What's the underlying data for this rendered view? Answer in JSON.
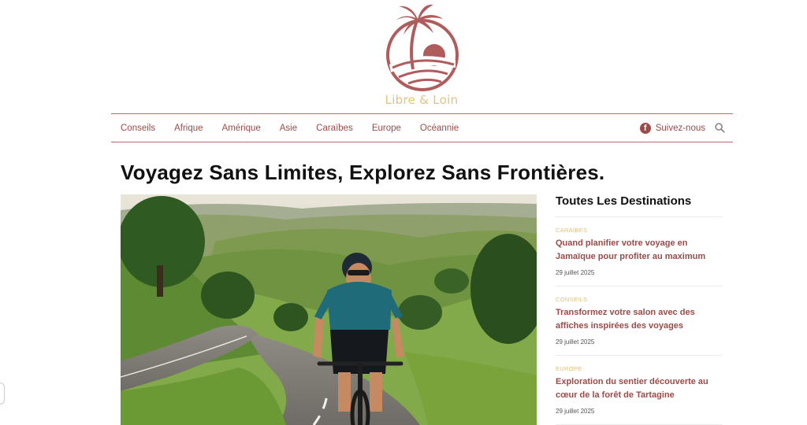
{
  "site": {
    "name": "Libre & Loin"
  },
  "nav": {
    "links": [
      "Conseils",
      "Afrique",
      "Amérique",
      "Asie",
      "Caraïbes",
      "Europe",
      "Océannie"
    ],
    "follow_label": "Suivez-nous",
    "follow_icon": "facebook-icon",
    "search_icon": "search-icon"
  },
  "headline": "Voyagez Sans Limites, Explorez Sans Frontières.",
  "sidebar": {
    "title": "Toutes Les Destinations",
    "articles": [
      {
        "category": "CARAÏBES",
        "title": "Quand planifier votre voyage en Jamaïque pour profiter au maximum",
        "date": "29 juillet 2025"
      },
      {
        "category": "CONSEILS",
        "title": "Transformez votre salon avec des affiches inspirées des voyages",
        "date": "29 juillet 2025"
      },
      {
        "category": "EUROPE",
        "title": "Exploration du sentier découverte au cœur de la forêt de Tartagine",
        "date": "29 juillet 2025"
      }
    ]
  },
  "colors": {
    "brand": "#9c4a4a",
    "logo_red": "#b05c5c",
    "accent_gold": "#e6c27a"
  }
}
